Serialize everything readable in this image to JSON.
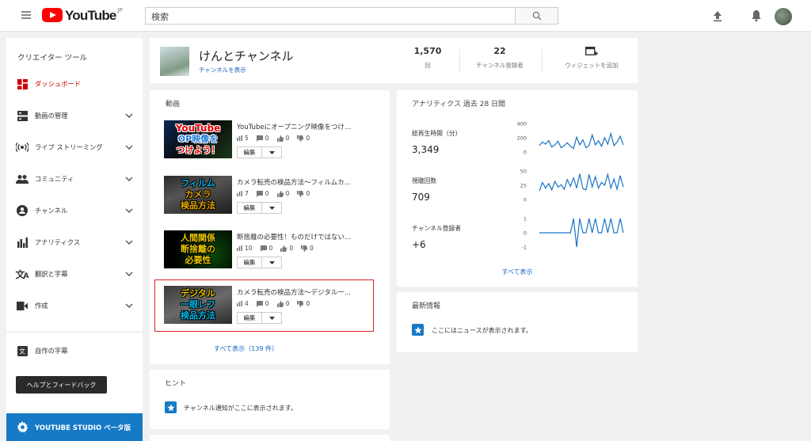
{
  "header": {
    "logo_text": "YouTube",
    "logo_region": "JP",
    "search_placeholder": "検索"
  },
  "sidebar": {
    "title": "クリエイター ツール",
    "items": [
      {
        "label": "ダッシュボード",
        "icon": "dashboard-icon",
        "active": true
      },
      {
        "label": "動画の管理",
        "icon": "video-manager-icon"
      },
      {
        "label": "ライブ ストリーミング",
        "icon": "live-icon"
      },
      {
        "label": "コミュニティ",
        "icon": "community-icon"
      },
      {
        "label": "チャンネル",
        "icon": "channel-icon"
      },
      {
        "label": "アナリティクス",
        "icon": "analytics-icon"
      },
      {
        "label": "翻訳と字幕",
        "icon": "translate-icon"
      },
      {
        "label": "作成",
        "icon": "create-icon"
      }
    ],
    "own_subtitles": "自作の字幕",
    "help_button": "ヘルプとフィードバック",
    "studio_label": "YOUTUBE STUDIO ベータ版",
    "active_color": "#cc0000"
  },
  "channel": {
    "name": "けんとチャンネル",
    "link": "チャンネルを表示",
    "views_value": "1,570",
    "views_label": "回",
    "subs_value": "22",
    "subs_label": "チャンネル登録者",
    "widget_label": "ウィジェットを追加"
  },
  "videos": {
    "title": "動画",
    "edit_label": "編集",
    "list": [
      {
        "title": "YouTubeにオープニング映像をつけ...",
        "views": "5",
        "comments": "0",
        "likes": "0",
        "dislikes": "0",
        "thumb_lines": [
          "YouTube",
          "OP映像を",
          "つけよう！"
        ]
      },
      {
        "title": "カメラ転売の検品方法〜フィルムカ...",
        "views": "7",
        "comments": "0",
        "likes": "0",
        "dislikes": "0",
        "thumb_lines": [
          "フィルム",
          "カメラ",
          "検品方法"
        ]
      },
      {
        "title": "断捨離の必要性！ものだけではない...",
        "views": "10",
        "comments": "0",
        "likes": "0",
        "dislikes": "0",
        "thumb_lines": [
          "人間関係",
          "断捨離の",
          "必要性"
        ]
      },
      {
        "title": "カメラ転売の検品方法〜デジタル一...",
        "views": "4",
        "comments": "0",
        "likes": "0",
        "dislikes": "0",
        "thumb_lines": [
          "デジタル",
          "一眼レフ",
          "検品方法"
        ]
      }
    ],
    "show_all": "すべて表示（139 件）"
  },
  "hint": {
    "title": "ヒント",
    "text": "チャンネル通知がここに表示されます。"
  },
  "analytics": {
    "title": "アナリティクス  過去 28 日間",
    "metrics": [
      {
        "label": "総再生時間（分）",
        "value": "3,349",
        "ticks": [
          "400",
          "200",
          "0"
        ]
      },
      {
        "label": "視聴回数",
        "value": "709",
        "ticks": [
          "50",
          "25",
          "0"
        ]
      },
      {
        "label": "チャンネル登録者",
        "value": "+6",
        "ticks": [
          "1",
          "0",
          "-1"
        ]
      }
    ],
    "show_all": "すべて表示",
    "line_color": "#1a73c8"
  },
  "chart_data": [
    {
      "type": "line",
      "ylim": [
        0,
        400
      ],
      "series": [
        {
          "values": [
            90,
            140,
            110,
            160,
            70,
            100,
            150,
            60,
            90,
            130,
            80,
            50,
            210,
            100,
            170,
            60,
            90,
            240,
            100,
            160,
            80,
            200,
            110,
            260,
            90,
            140,
            220,
            100
          ]
        }
      ]
    },
    {
      "type": "line",
      "ylim": [
        0,
        50
      ],
      "series": [
        {
          "values": [
            15,
            30,
            20,
            28,
            17,
            32,
            22,
            26,
            18,
            35,
            23,
            38,
            20,
            45,
            19,
            17,
            44,
            22,
            40,
            20,
            30,
            25,
            44,
            20,
            36,
            18,
            42,
            22
          ]
        }
      ]
    },
    {
      "type": "line",
      "ylim": [
        -1,
        1
      ],
      "series": [
        {
          "values": [
            0,
            0,
            0,
            0,
            0,
            0,
            0,
            0,
            0,
            0,
            0,
            1,
            -1,
            1,
            0,
            0,
            1,
            0,
            1,
            0,
            0,
            1,
            0,
            1,
            0,
            0,
            1,
            0
          ]
        }
      ]
    }
  ],
  "news": {
    "title": "最新情報",
    "text": "ここにはニュースが表示されます。"
  }
}
